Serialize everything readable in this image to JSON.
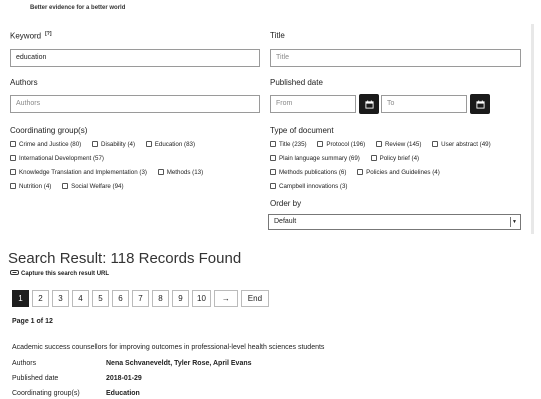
{
  "header": {
    "tagline": "Better evidence for a better world"
  },
  "search_form": {
    "keyword": {
      "label": "Keyword",
      "help_marker": "[?]",
      "value": "education"
    },
    "title": {
      "label": "Title",
      "placeholder": "Title"
    },
    "authors": {
      "label": "Authors",
      "placeholder": "Authors"
    },
    "published_date": {
      "label": "Published date",
      "from_placeholder": "From",
      "to_placeholder": "To"
    },
    "coordinating_group": {
      "label": "Coordinating group(s)",
      "rows": [
        [
          "Crime and Justice (80)",
          "Disability (4)",
          "Education (83)"
        ],
        [
          "International Development (57)"
        ],
        [
          "Knowledge Translation and Implementation (3)",
          "Methods (13)"
        ],
        [
          "Nutrition (4)",
          "Social Welfare (94)"
        ]
      ]
    },
    "type_of_document": {
      "label": "Type of document",
      "rows": [
        [
          "Title (235)",
          "Protocol (196)",
          "Review (145)",
          "User abstract (49)"
        ],
        [
          "Plain language summary (69)",
          "Policy brief (4)"
        ],
        [
          "Methods publications (6)",
          "Policies and Guidelines (4)"
        ],
        [
          "Campbell innovations (3)"
        ]
      ]
    },
    "order_by": {
      "label": "Order by",
      "value": "Default"
    }
  },
  "results": {
    "heading": "Search Result: 118 Records Found",
    "capture_link": "Capture this search result URL",
    "pagination": [
      "1",
      "2",
      "3",
      "4",
      "5",
      "6",
      "7",
      "8",
      "9",
      "10",
      "→",
      "End"
    ],
    "active_page": "1",
    "page_info": "Page 1 of 12",
    "first_record": {
      "title": "Academic success counsellors for improving outcomes in professional-level health sciences students",
      "fields": [
        {
          "key": "Authors",
          "value": "Nena Schvaneveldt, Tyler Rose, April Evans"
        },
        {
          "key": "Published date",
          "value": "2018-01-29"
        },
        {
          "key": "Coordinating group(s)",
          "value": "Education"
        }
      ]
    }
  }
}
